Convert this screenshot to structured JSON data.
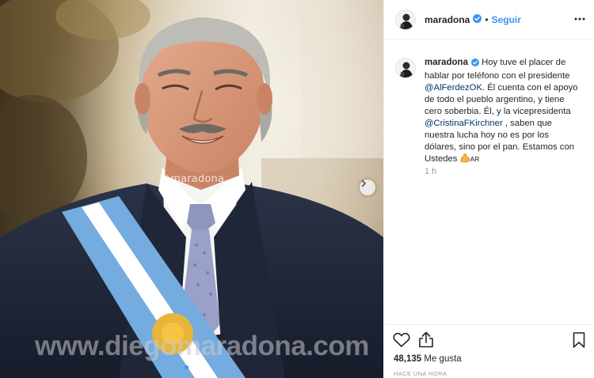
{
  "post": {
    "photo": {
      "credit": "©maradona",
      "watermark": "www.diegomaradona.com",
      "carousel_dots": 2,
      "active_dot": 1
    },
    "header": {
      "username": "maradona",
      "separator": "•",
      "follow_label": "Seguir"
    },
    "caption": {
      "username": "maradona",
      "text_1": "Hoy tuve el placer de hablar por teléfono con el presidente ",
      "mention_1": "@AlFerdezOK",
      "text_2": ". Él cuenta con el apoyo de todo el pueblo argentino, y tiene cero soberbia. Él, y la vicepresidenta ",
      "mention_2": "@CristinaFKirchner",
      "text_3": " , saben que nuestra lucha hoy no es por los dólares, sino por el pan. Estamos con Ustedes ",
      "emoji_flag": "AR"
    },
    "timestamp": "1 h",
    "likes_count": "48,135",
    "likes_label": "Me gusta",
    "posted_ago": "HACE UNA HORA"
  },
  "colors": {
    "accent_blue": "#3897f0",
    "mention_blue": "#003569",
    "muted_text": "#999999",
    "border": "#efefef"
  },
  "icons": [
    "verified-badge-icon",
    "more-options-icon",
    "next-arrow-icon",
    "heart-icon",
    "share-icon",
    "bookmark-icon",
    "flexed-biceps-emoji"
  ]
}
